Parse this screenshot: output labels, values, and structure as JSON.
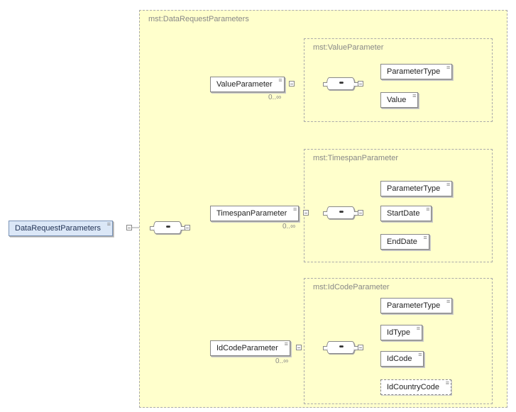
{
  "outer": {
    "title": "mst:DataRequestParameters"
  },
  "root": {
    "label": "DataRequestParameters"
  },
  "group1": {
    "title": "mst:ValueParameter",
    "parent": "ValueParameter",
    "card": "0..∞",
    "children": [
      "ParameterType",
      "Value"
    ]
  },
  "group2": {
    "title": "mst:TimespanParameter",
    "parent": "TimespanParameter",
    "card": "0..∞",
    "children": [
      "ParameterType",
      "StartDate",
      "EndDate"
    ]
  },
  "group3": {
    "title": "mst:IdCodeParameter",
    "parent": "IdCodeParameter",
    "card": "0..∞",
    "children": [
      "ParameterType",
      "IdType",
      "IdCode"
    ],
    "optional": "IdCountryCode"
  }
}
